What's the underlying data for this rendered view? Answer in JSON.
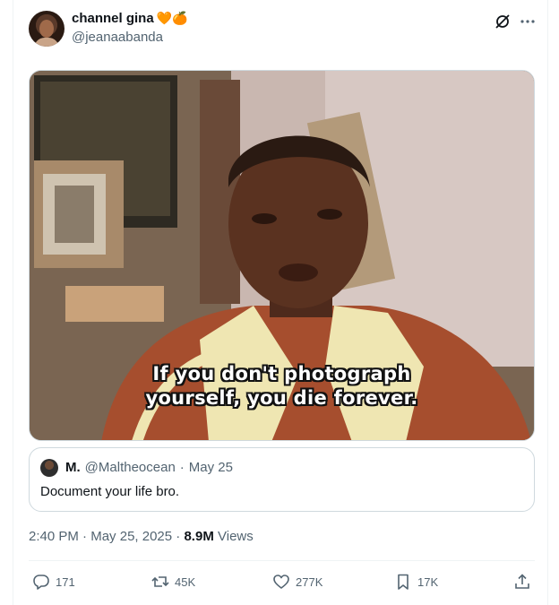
{
  "author": {
    "name": "channel gina",
    "emojis": "🧡🍊",
    "handle": "@jeanaabanda"
  },
  "icons": {
    "top": [
      "grok-icon",
      "more-icon"
    ],
    "actions": [
      "reply-icon",
      "repost-icon",
      "like-icon",
      "bookmark-icon",
      "share-icon"
    ]
  },
  "media": {
    "subtitle_line1": "If you don't photograph",
    "subtitle_line2": "yourself, you die forever."
  },
  "quote": {
    "name": "M.",
    "handle": "@Maltheocean",
    "separator": "·",
    "date": "May 25",
    "text": "Document your life bro."
  },
  "meta": {
    "time": "2:40 PM",
    "separator": "·",
    "date": "May 25, 2025",
    "views_count": "8.9M",
    "views_label": "Views"
  },
  "actions": {
    "replies": "171",
    "reposts": "45K",
    "likes": "277K",
    "bookmarks": "17K"
  },
  "colors": {
    "text_primary": "#0f1419",
    "text_secondary": "#536471",
    "border": "#cfd9de"
  }
}
